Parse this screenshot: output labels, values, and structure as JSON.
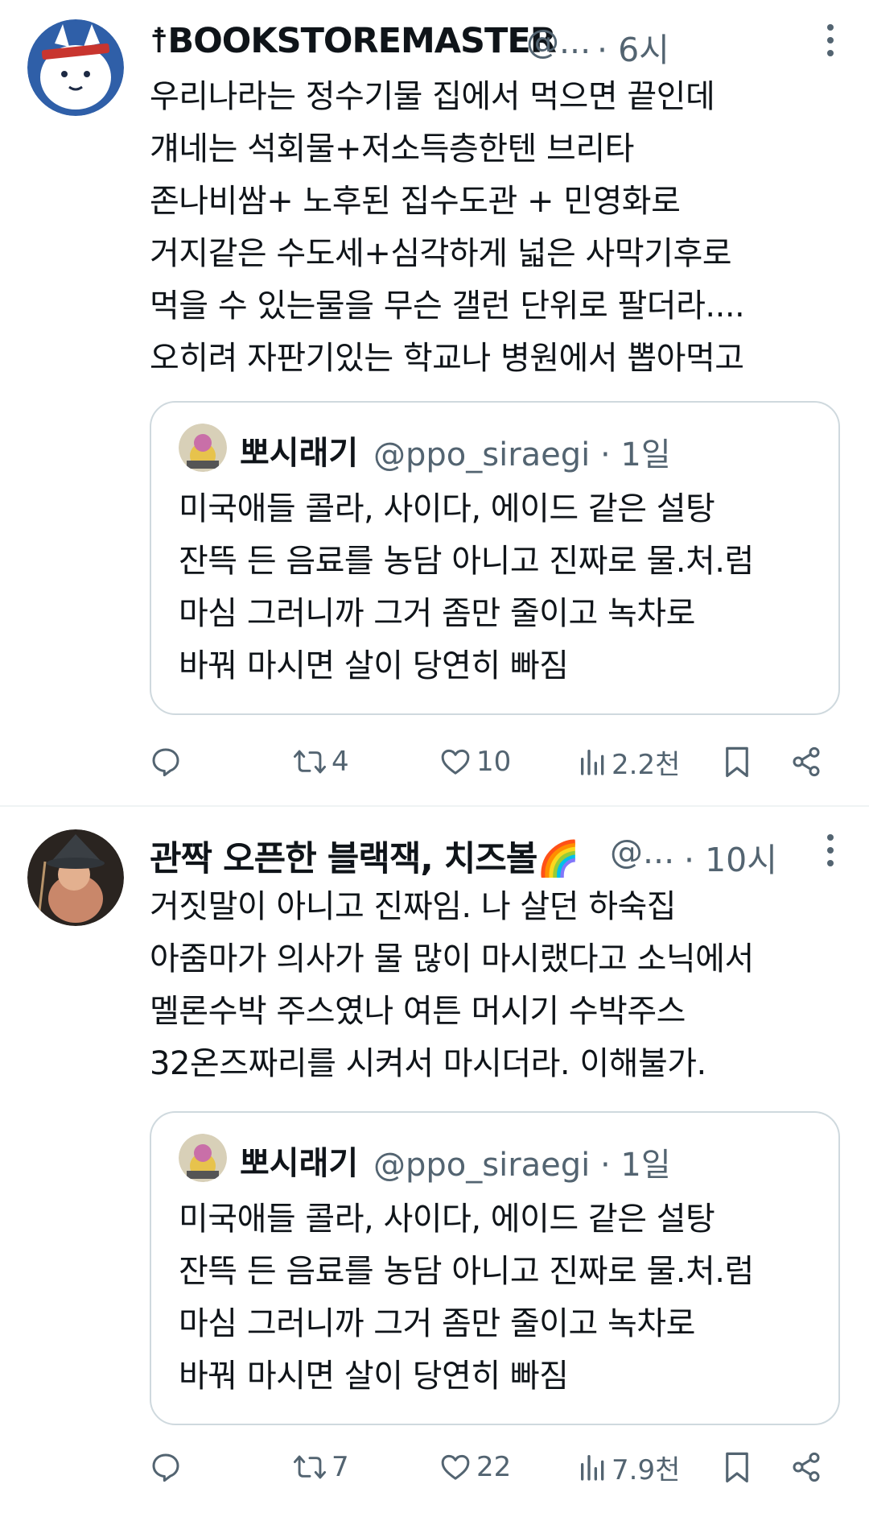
{
  "tweets": [
    {
      "author_name": "☨BOOKSTOREMASTER",
      "handle": "@...",
      "time": "· 6시",
      "text_lines": [
        "우리나라는 정수기물 집에서 먹으면 끝인데",
        "걔네는 석회물+저소득층한텐 브리타",
        "존나비쌈+ 노후된 집수도관 + 민영화로",
        "거지같은 수도세+심각하게 넓은 사막기후로",
        "먹을 수 있는물을 무슨 갤런 단위로 팔더라....",
        "오히려 자판기있는 학교나 병원에서 뽑아먹고"
      ],
      "quote": {
        "author_name": "뽀시래기",
        "handle_time": "@ppo_siraegi · 1일",
        "text_lines": [
          "미국애들 콜라, 사이다, 에이드 같은 설탕",
          "잔뜩 든 음료를 농담 아니고 진짜로 물.처.럼",
          "마심 그러니까 그거 좀만 줄이고 녹차로",
          "바꿔 마시면 살이 당연히 빠짐"
        ]
      },
      "actions": {
        "replies": "",
        "retweets": "4",
        "likes": "10",
        "views": "2.2천"
      }
    },
    {
      "author_name": "관짝 오픈한 블랙잭, 치즈볼🌈",
      "handle": "@...",
      "time": "· 10시",
      "text_lines": [
        "거짓말이 아니고 진짜임. 나 살던 하숙집",
        "아줌마가 의사가 물 많이 마시랬다고 소닉에서",
        "멜론수박 주스였나 여튼 머시기 수박주스",
        "32온즈짜리를 시켜서 마시더라. 이해불가."
      ],
      "quote": {
        "author_name": "뽀시래기",
        "handle_time": "@ppo_siraegi · 1일",
        "text_lines": [
          "미국애들 콜라, 사이다, 에이드 같은 설탕",
          "잔뜩 든 음료를 농담 아니고 진짜로 물.처.럼",
          "마심 그러니까 그거 좀만 줄이고 녹차로",
          "바꿔 마시면 살이 당연히 빠짐"
        ]
      },
      "actions": {
        "replies": "",
        "retweets": "7",
        "likes": "22",
        "views": "7.9천"
      }
    }
  ],
  "colors": {
    "text": "#0f1419",
    "secondary": "#536471",
    "border": "#cfd9de",
    "divider": "#eff3f4"
  },
  "icons": [
    "reply-icon",
    "retweet-icon",
    "like-icon",
    "views-icon",
    "bookmark-icon",
    "share-icon",
    "more-icon"
  ]
}
